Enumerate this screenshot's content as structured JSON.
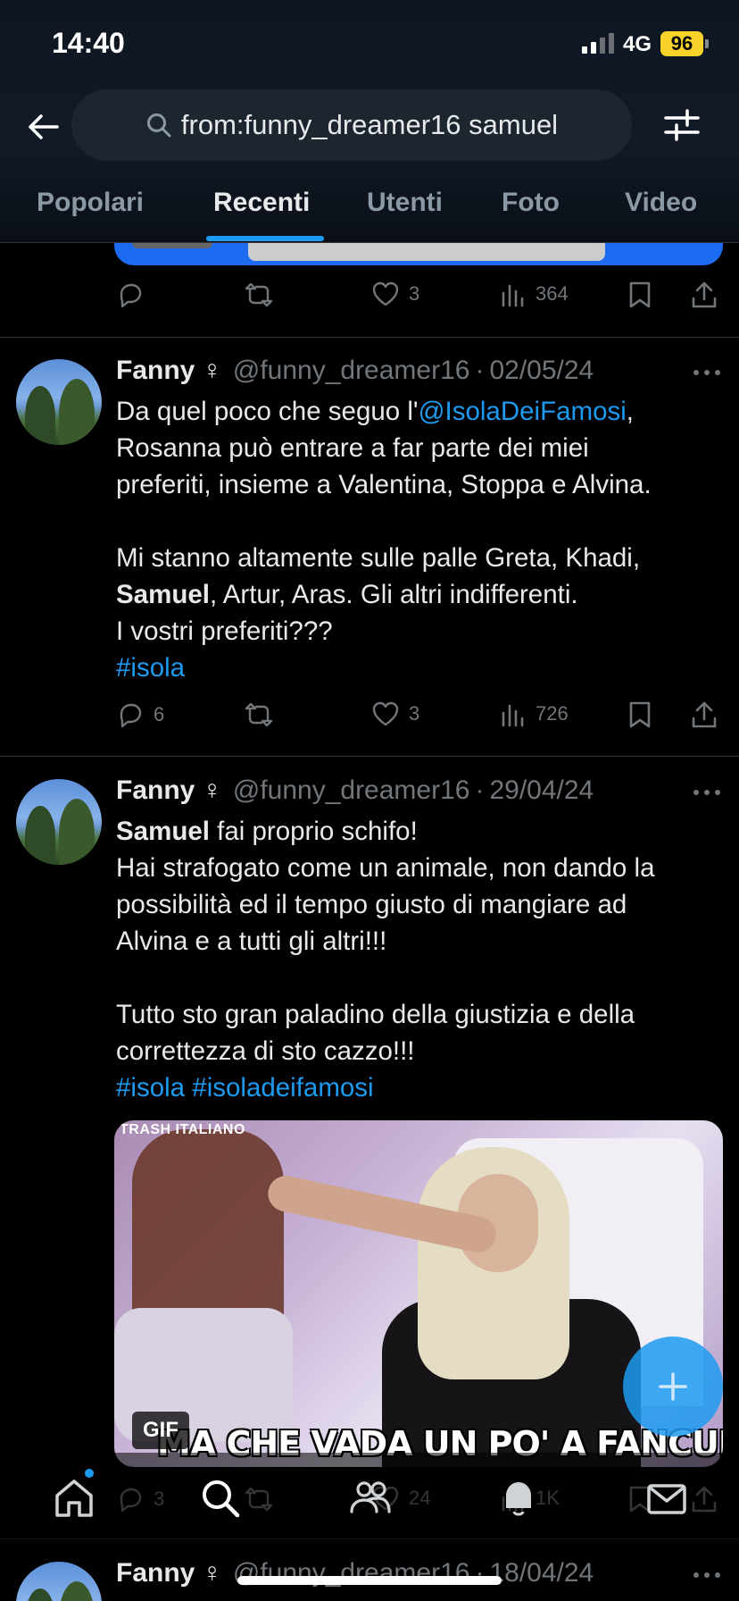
{
  "status_bar": {
    "time": "14:40",
    "network": "4G",
    "battery": "96"
  },
  "search": {
    "query": "from:funny_dreamer16 samuel"
  },
  "tabs": [
    {
      "label": "Popolari"
    },
    {
      "label": "Recenti"
    },
    {
      "label": "Utenti"
    },
    {
      "label": "Foto"
    },
    {
      "label": "Video"
    }
  ],
  "active_tab": "Recenti",
  "tweets": [
    {
      "stats": {
        "replies": "",
        "retweets": "",
        "likes": "3",
        "views": "364"
      }
    },
    {
      "name": "Fanny",
      "gender_symbol": "♀",
      "handle": "@funny_dreamer16",
      "date": "02/05/24",
      "text": {
        "l1_a": "Da quel poco che seguo l'",
        "l1_mention": "@IsolaDeiFamosi",
        "l1_b": ",",
        "l2": "Rosanna può entrare a far parte dei miei",
        "l3": "preferiti, insieme a Valentina, Stoppa e Alvina.",
        "l5": "Mi stanno altamente sulle palle Greta, Khadi,",
        "l6_bold": "Samuel",
        "l6_rest": ", Artur, Aras. Gli altri indifferenti.",
        "l7": "I vostri preferiti???",
        "hashtag": "#isola"
      },
      "stats": {
        "replies": "6",
        "retweets": "",
        "likes": "3",
        "views": "726"
      }
    },
    {
      "name": "Fanny",
      "gender_symbol": "♀",
      "handle": "@funny_dreamer16",
      "date": "29/04/24",
      "text": {
        "l1_bold": "Samuel",
        "l1_rest": " fai proprio schifo!",
        "l2": "Hai strafogato come un animale, non dando la",
        "l3": "possibilità ed il tempo giusto di mangiare ad",
        "l4": "Alvina e a tutti gli altri!!!",
        "l6": "Tutto sto gran paladino della giustizia e della",
        "l7": "correttezza di sto cazzo!!!",
        "hashtag1": "#isola",
        "hashtag2": "#isoladeifamosi"
      },
      "media": {
        "badge": "GIF",
        "caption": "MA CHE VADA UN PO' A FANCULO",
        "watermark": "TRASH ITALIANO"
      },
      "stats": {
        "replies": "3",
        "retweets": "",
        "likes": "24",
        "views": "1K"
      }
    },
    {
      "name": "Fanny",
      "gender_symbol": "♀",
      "handle": "@funny_dreamer16",
      "date": "18/04/24"
    }
  ],
  "colors": {
    "accent": "#1d9bf0",
    "muted": "#71767b",
    "text": "#e7e9ea",
    "battery": "#f8d32a"
  },
  "icons": [
    "back-arrow-icon",
    "search-icon",
    "filter-sliders-icon",
    "reply-icon",
    "retweet-icon",
    "like-icon",
    "views-icon",
    "bookmark-icon",
    "share-icon",
    "more-icon",
    "compose-plus-icon",
    "home-icon",
    "explore-icon",
    "communities-icon",
    "notifications-icon",
    "messages-icon"
  ]
}
